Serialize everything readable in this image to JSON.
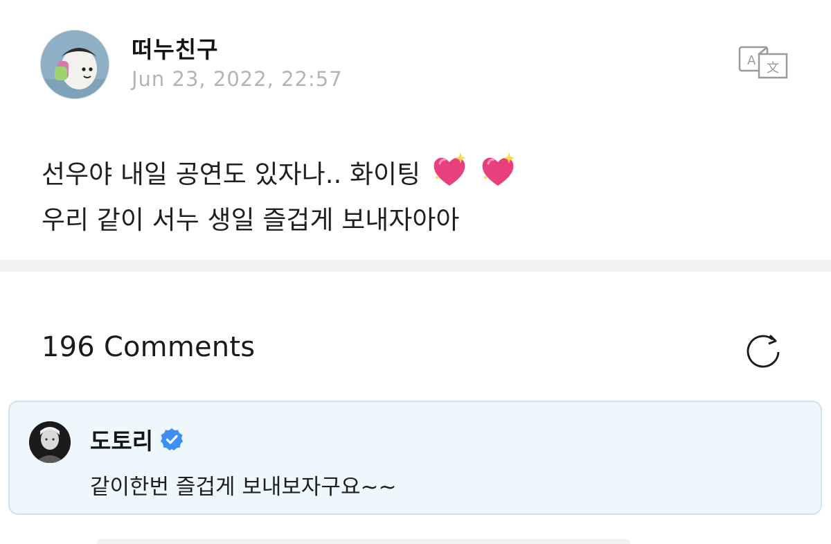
{
  "post": {
    "author": "떠누친구",
    "timestamp": "Jun 23, 2022, 22:57",
    "avatar_icon": "cartoon-character-avatar",
    "translate_icon": "translate-icon",
    "body_line1": "선우야 내일 공연도 있자나.. 화이팅",
    "body_line1_emojis": [
      "sparkling-heart-emoji",
      "sparkling-heart-emoji"
    ],
    "body_line2": "우리 같이 서누 생일 즐겁게 보내자아아"
  },
  "comments": {
    "header": "196 Comments",
    "refresh_icon": "refresh-icon",
    "items": [
      {
        "author": "도토리",
        "verified": true,
        "verified_icon": "verified-badge-icon",
        "text": "같이한번 즐겁게 보내보자구요~~",
        "highlighted": true
      }
    ]
  },
  "colors": {
    "timestamp": "#b4b4b4",
    "divider": "#f2f2f4",
    "highlight_bg": "#eef7fb",
    "highlight_border": "#cfe3ee",
    "verified": "#3b8ff5",
    "heart": "#e8407f"
  }
}
